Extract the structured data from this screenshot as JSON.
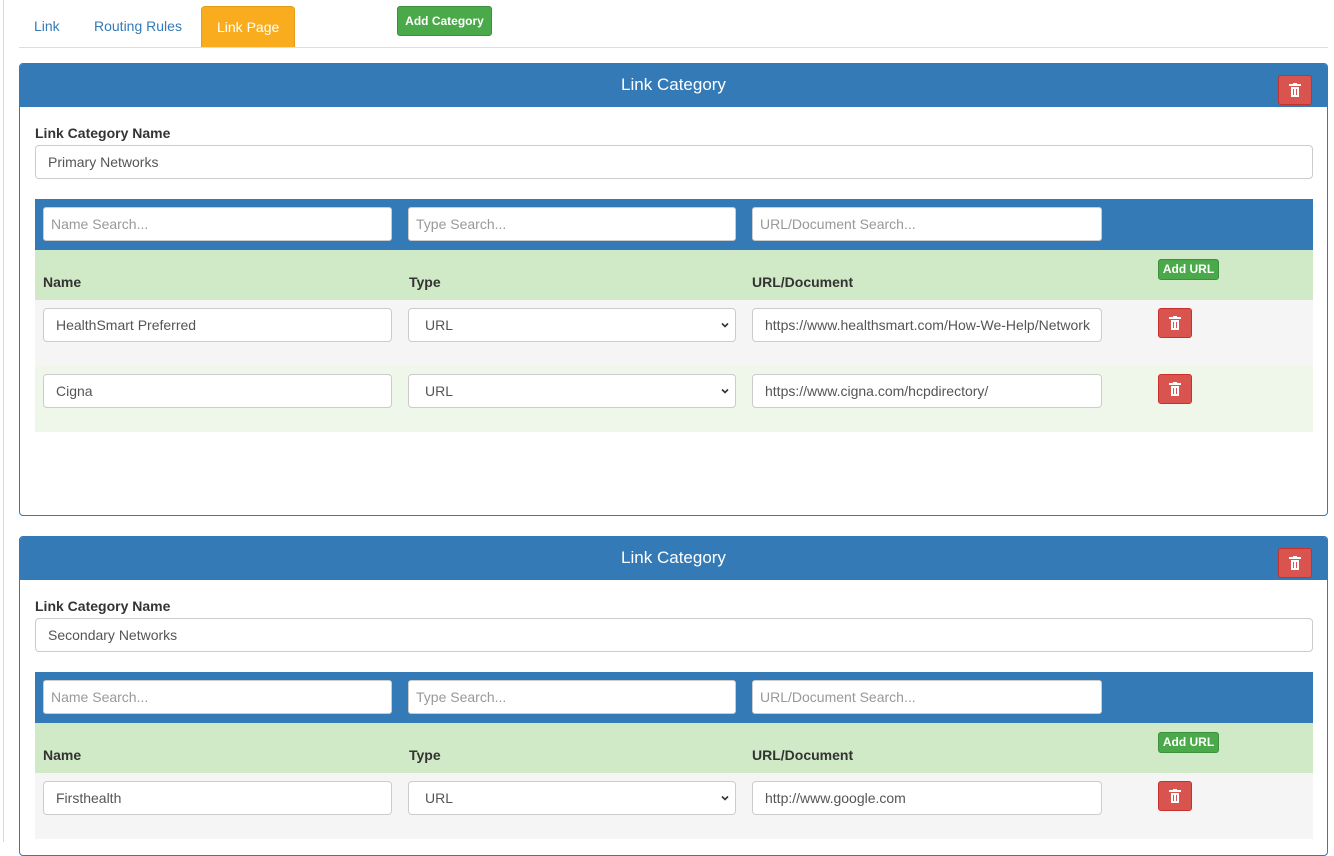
{
  "tabs": [
    {
      "label": "Link"
    },
    {
      "label": "Routing Rules"
    },
    {
      "label": "Link Page"
    }
  ],
  "toolbar": {
    "add_category_label": "Add Category"
  },
  "categories": [
    {
      "heading": "Link Category",
      "name_label": "Link Category Name",
      "name_value": "Primary Networks",
      "search": {
        "name_placeholder": "Name Search...",
        "type_placeholder": "Type Search...",
        "url_placeholder": "URL/Document Search..."
      },
      "columns": {
        "name": "Name",
        "type": "Type",
        "url": "URL/Document"
      },
      "add_url_label": "Add URL",
      "rows": [
        {
          "name": "HealthSmart Preferred",
          "type": "URL",
          "url": "https://www.healthsmart.com/How-We-Help/Network"
        },
        {
          "name": "Cigna",
          "type": "URL",
          "url": "https://www.cigna.com/hcpdirectory/"
        }
      ]
    },
    {
      "heading": "Link Category",
      "name_label": "Link Category Name",
      "name_value": "Secondary Networks",
      "search": {
        "name_placeholder": "Name Search...",
        "type_placeholder": "Type Search...",
        "url_placeholder": "URL/Document Search..."
      },
      "columns": {
        "name": "Name",
        "type": "Type",
        "url": "URL/Document"
      },
      "add_url_label": "Add URL",
      "rows": [
        {
          "name": "Firsthealth",
          "type": "URL",
          "url": "http://www.google.com"
        }
      ]
    }
  ],
  "icons": {
    "delete": "trash-icon",
    "dropdown": "chevron-down-icon"
  },
  "colors": {
    "primary": "#337ab7",
    "active_tab": "#f9ad1e",
    "success": "#4aa948",
    "danger": "#d9534f",
    "header_row": "#d0e9c6"
  }
}
